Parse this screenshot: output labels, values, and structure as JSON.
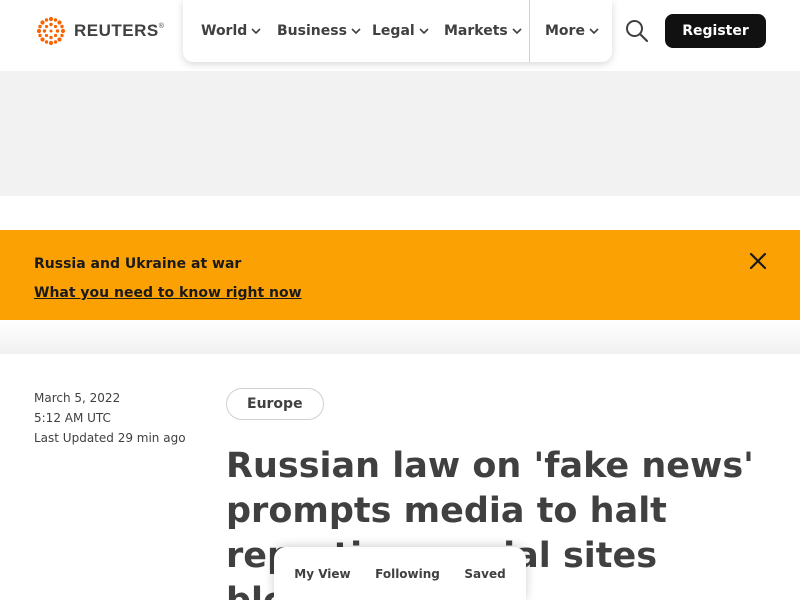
{
  "brand": {
    "name": "REUTERS",
    "registered": "®"
  },
  "nav": {
    "items": [
      {
        "label": "World"
      },
      {
        "label": "Business"
      },
      {
        "label": "Legal"
      },
      {
        "label": "Markets"
      }
    ],
    "more_label": "More"
  },
  "header": {
    "register_label": "Register",
    "search_icon": "search-icon"
  },
  "banner": {
    "title": "Russia and Ukraine at war",
    "link": "What you need to know right now",
    "background_color": "#fca104"
  },
  "article": {
    "date": "March 5, 2022",
    "time": "5:12 AM UTC",
    "last_updated": "Last Updated 29 min ago",
    "tag": "Europe",
    "headline": "Russian law on 'fake news' prompts media to halt reporting, social sites blocked"
  },
  "bottom_bar": {
    "items": [
      "My View",
      "Following",
      "Saved"
    ]
  }
}
